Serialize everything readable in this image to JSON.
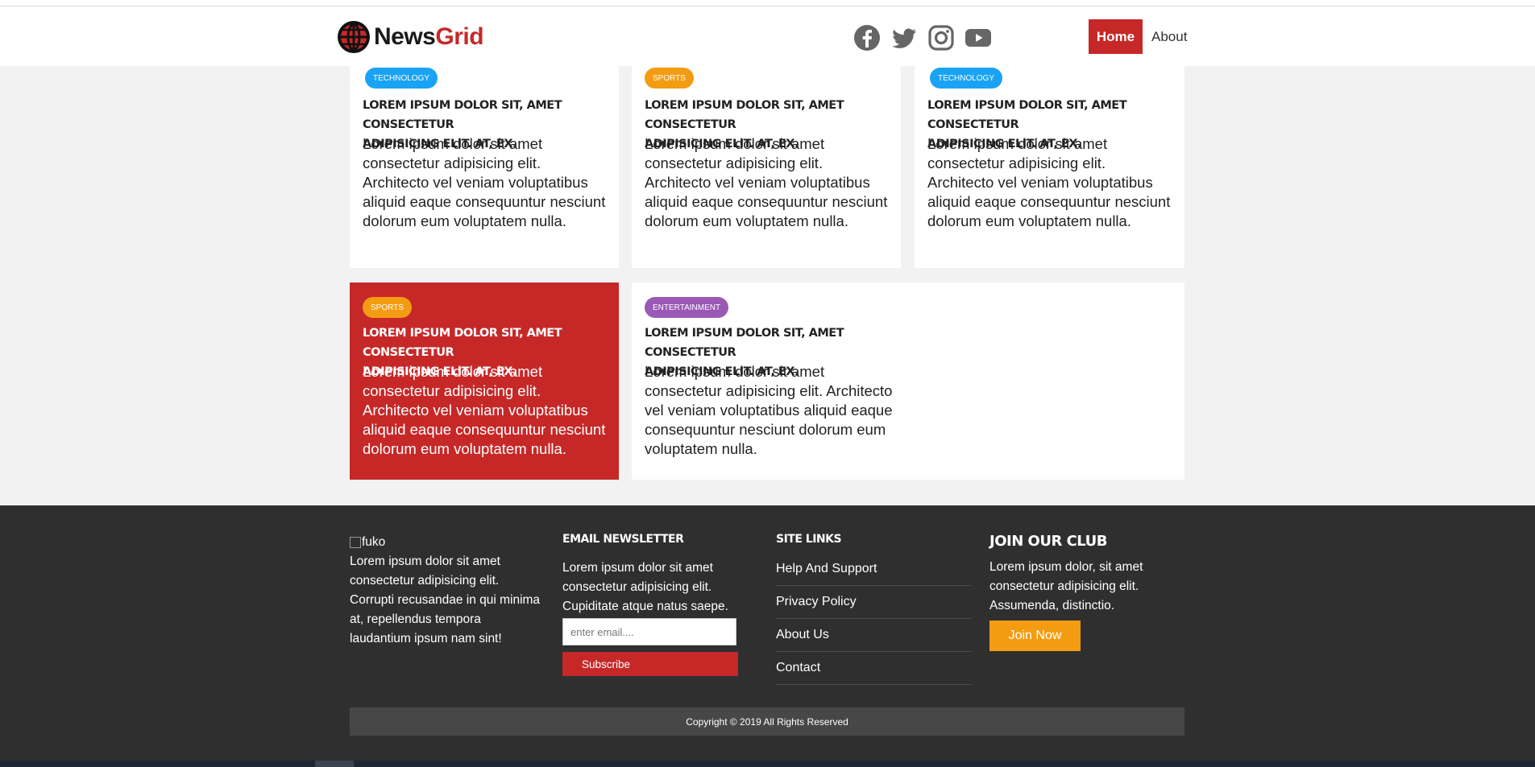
{
  "header": {
    "logo_text_a": "News",
    "logo_text_b": "Grid",
    "social_icons": [
      "facebook-icon",
      "twitter-icon",
      "instagram-icon",
      "youtube-icon"
    ],
    "nav": {
      "home": "Home",
      "about": "About"
    }
  },
  "colors": {
    "accent_red": "#c62828",
    "technology": "#1aa3f5",
    "sports": "#f39c12",
    "entertainment": "#9b59b6",
    "footer_bg": "#2f2f2f"
  },
  "cards": [
    {
      "category": "TECHNOLOGY",
      "title_line1": "LOREM IPSUM DOLOR SIT, AMET CONSECTETUR",
      "title_line2": "ADIPISICING ELIT. AT, EX.",
      "body": "Lorem ipsum dolor sit amet consectetur adipisicing elit. Architecto vel veniam voluptatibus aliquid eaque consequuntur nesciunt dolorum eum voluptatem nulla."
    },
    {
      "category": "SPORTS",
      "title_line1": "LOREM IPSUM DOLOR SIT, AMET CONSECTETUR",
      "title_line2": "ADIPISICING ELIT. AT, EX.",
      "body": "Lorem ipsum dolor sit amet consectetur adipisicing elit. Architecto vel veniam voluptatibus aliquid eaque consequuntur nesciunt dolorum eum voluptatem nulla."
    },
    {
      "category": "TECHNOLOGY",
      "title_line1": "LOREM IPSUM DOLOR SIT, AMET CONSECTETUR",
      "title_line2": "ADIPISICING ELIT. AT, EX.",
      "body": "Lorem ipsum dolor sit amet consectetur adipisicing elit. Architecto vel veniam voluptatibus aliquid eaque consequuntur nesciunt dolorum eum voluptatem nulla."
    },
    {
      "category": "SPORTS",
      "title_line1": "LOREM IPSUM DOLOR SIT, AMET CONSECTETUR",
      "title_line2": "ADIPISICING ELIT. AT, EX.",
      "body": "Lorem ipsum dolor sit amet consectetur adipisicing elit. Architecto vel veniam voluptatibus aliquid eaque consequuntur nesciunt dolorum eum voluptatem nulla."
    },
    {
      "category": "ENTERTAINMENT",
      "title_line1": "LOREM IPSUM DOLOR SIT, AMET CONSECTETUR",
      "title_line2": "ADIPISICING ELIT. AT, EX.",
      "body": "Lorem ipsum dolor sit amet consectetur adipisicing elit. Architecto vel veniam voluptatibus aliquid eaque consequuntur nesciunt dolorum eum voluptatem nulla."
    }
  ],
  "footer": {
    "about": {
      "image_alt": "fuko",
      "text": "Lorem ipsum dolor sit amet consectetur adipisicing elit. Corrupti recusandae in qui minima at, repellendus tempora laudantium ipsum nam sint!"
    },
    "newsletter": {
      "heading": "EMAIL NEWSLETTER",
      "text": "Lorem ipsum dolor sit amet consectetur adipisicing elit. Cupiditate atque natus saepe.",
      "email_placeholder": "enter email....",
      "subscribe": "Subscribe"
    },
    "site_links": {
      "heading": "SITE LINKS",
      "items": [
        "Help And Support",
        "Privacy Policy",
        "About Us",
        "Contact"
      ]
    },
    "club": {
      "heading": "JOIN OUR CLUB",
      "text": "Lorem ipsum dolor, sit amet consectetur adipisicing elit. Assumenda, distinctio.",
      "button": "Join Now"
    },
    "copyright": "Copyright © 2019 All Rights Reserved"
  }
}
